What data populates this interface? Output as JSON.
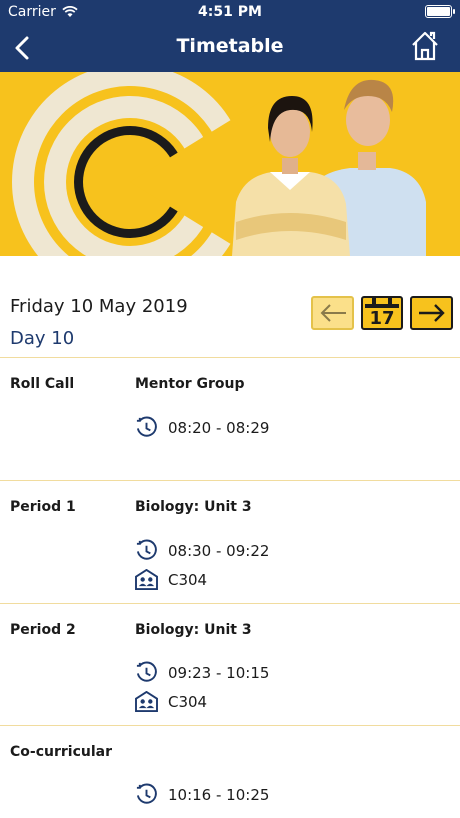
{
  "status": {
    "carrier": "Carrier",
    "time": "4:51 PM"
  },
  "header": {
    "title": "Timetable"
  },
  "date": {
    "label": "Friday 10 May 2019",
    "day": "Day 10"
  },
  "calendar_button": {
    "number": "17"
  },
  "colors": {
    "navy": "#1e3a6e",
    "yellow": "#f7c21d",
    "pale_yellow": "#fbe08a"
  },
  "rows": [
    {
      "label": "Roll Call",
      "subject": "Mentor Group",
      "time": "08:20 - 08:29"
    },
    {
      "label": "Period 1",
      "subject": "Biology: Unit 3",
      "time": "08:30 - 09:22",
      "room": "C304"
    },
    {
      "label": "Period 2",
      "subject": "Biology: Unit 3",
      "time": "09:23 - 10:15",
      "room": "C304"
    },
    {
      "label": "Co-curricular",
      "subject": "",
      "time": "10:16 - 10:25"
    }
  ]
}
